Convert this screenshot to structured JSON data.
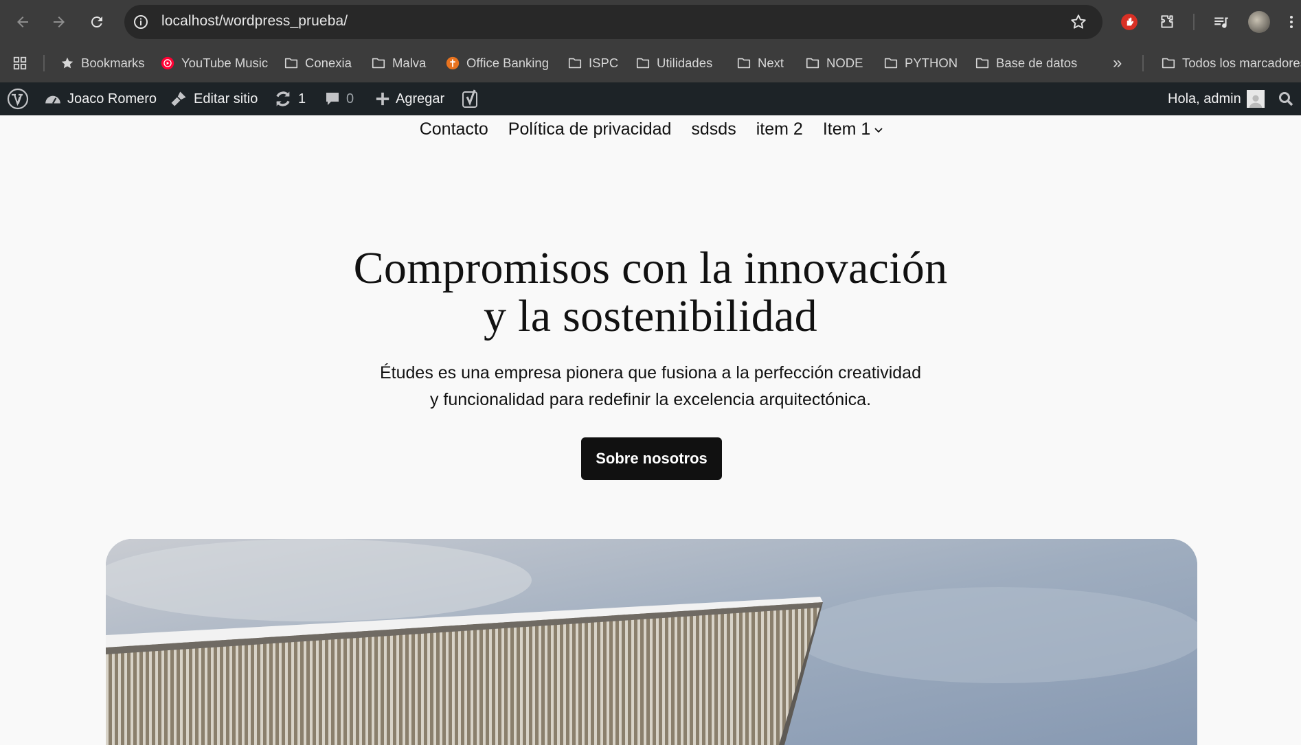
{
  "browser": {
    "url": "localhost/wordpress_prueba/",
    "bookmarks": [
      {
        "label": "Bookmarks",
        "icon": "star-icon"
      },
      {
        "label": "YouTube Music",
        "icon": "youtube-music-icon"
      },
      {
        "label": "Conexia",
        "icon": "folder-icon"
      },
      {
        "label": "Malva",
        "icon": "folder-icon"
      },
      {
        "label": "Office Banking",
        "icon": "office-banking-icon"
      },
      {
        "label": "ISPC",
        "icon": "folder-icon"
      },
      {
        "label": "Utilidades",
        "icon": "folder-icon"
      },
      {
        "label": "Next",
        "icon": "folder-icon"
      },
      {
        "label": "NODE",
        "icon": "folder-icon"
      },
      {
        "label": "PYTHON",
        "icon": "folder-icon"
      },
      {
        "label": "Base de datos",
        "icon": "folder-icon"
      }
    ],
    "overflow_label": "»",
    "all_bookmarks_label": "Todos los marcadores"
  },
  "adminbar": {
    "site_name": "Joaco Romero",
    "edit_site": "Editar sitio",
    "updates_count": "1",
    "comments_count": "0",
    "add_new": "Agregar",
    "greeting": "Hola, admin"
  },
  "site_nav": {
    "items": [
      "Contacto",
      "Política de privacidad",
      "sdsds",
      "item 2",
      "Item 1"
    ]
  },
  "hero": {
    "title_line1": "Compromisos con la innovación",
    "title_line2": "y la sostenibilidad",
    "subtitle_line1": "Études es una empresa pionera que fusiona a la perfección creatividad",
    "subtitle_line2": "y funcionalidad para redefinir la excelencia arquitectónica.",
    "cta_label": "Sobre nosotros"
  },
  "colors": {
    "chrome_bg": "#3c3c3c",
    "adminbar_bg": "#1d2327",
    "page_bg": "#f9f9f9",
    "cta_bg": "#111111"
  }
}
